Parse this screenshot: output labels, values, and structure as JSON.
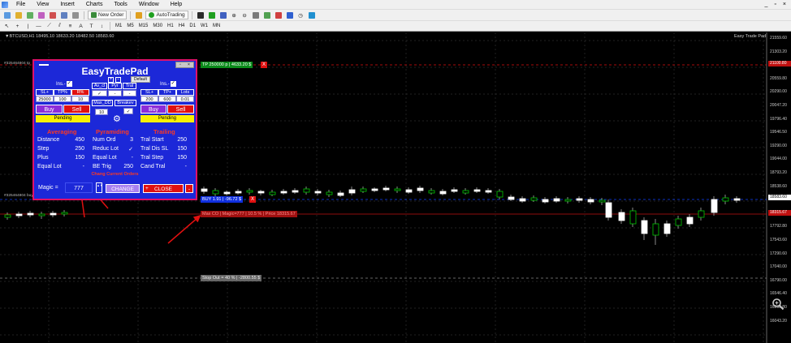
{
  "menu": [
    "File",
    "View",
    "Insert",
    "Charts",
    "Tools",
    "Window",
    "Help"
  ],
  "window_controls": [
    "_",
    "▫",
    "×"
  ],
  "toolbar": {
    "new_order": "New Order",
    "auto_trading": "AutoTrading",
    "timeframes": [
      "M1",
      "M5",
      "M15",
      "M30",
      "H1",
      "H4",
      "D1",
      "W1",
      "MN"
    ]
  },
  "chart": {
    "title": "▼BTCUSD,H1  18495.10 18633.20 18482.50 18583.60",
    "ea_name": "Easy Trade Pad",
    "tp_line": "TP 250000 p | 4633.20 $",
    "buy_line": "BUY 1.91 | -96.72 $",
    "max_line": "Max CO | Magic=777 | 10.5 % | Price 18315.67",
    "stopout_line": "Stop Out = 40 % | -2800.55 $",
    "close_x": "X",
    "ticket_tp": "#325464804 tp",
    "ticket_buy": "#325464804 buy",
    "price_axis": [
      "21559.60",
      "21303.20",
      "21036.80",
      "20559.80",
      "20290.00",
      "20047.20",
      "19796.40",
      "19546.50",
      "19290.00",
      "19044.00",
      "18793.20",
      "18538.60",
      "18290.00",
      "18031.00",
      "17792.80",
      "17543.60",
      "17290.60",
      "17040.00",
      "16790.00",
      "16546.40",
      "16290.80",
      "16043.20"
    ],
    "current_price": "18583.60",
    "red_price": "18315.67",
    "top_price": "21100.80"
  },
  "panel": {
    "title": "EasyTradePad",
    "mini_buttons": [
      "+",
      "-"
    ],
    "default_label": "Default",
    "title_controls": [
      "▫",
      "×"
    ],
    "ins_label": "Ins.-",
    "check": "✓",
    "left": {
      "headers": [
        "SL+",
        "TP%",
        "R%"
      ],
      "values": [
        "25000",
        "100",
        "10"
      ]
    },
    "middle": {
      "headers": [
        "Av_cl",
        "Pyr",
        "Tral"
      ],
      "row2": [
        "✓",
        "-",
        "-"
      ],
      "max_dd_label": "Max_DD",
      "breakeven_label": "Breakev",
      "max_dd_value": "10"
    },
    "right": {
      "headers": [
        "SL+",
        "TP+",
        "Lots"
      ],
      "values": [
        "200",
        "600",
        "0.01"
      ]
    },
    "buy": "Buy",
    "sell": "Sell",
    "pending": "Pending",
    "averaging": {
      "title": "Averaging",
      "rows": [
        {
          "label": "Distance",
          "value": "450"
        },
        {
          "label": "Step",
          "value": "250"
        },
        {
          "label": "Plus",
          "value": "150"
        },
        {
          "label": "Equal Lot",
          "value": "-"
        }
      ]
    },
    "pyramiding": {
      "title": "Pyramiding",
      "rows": [
        {
          "label": "Num Ord",
          "value": "3"
        },
        {
          "label": "Reduc Lot",
          "value": "✓"
        },
        {
          "label": "Equal Lot",
          "value": "-"
        },
        {
          "label": "BE Trig",
          "value": "250"
        }
      ]
    },
    "trailing": {
      "title": "Trailing",
      "rows": [
        {
          "label": "Tral Start",
          "value": "250"
        },
        {
          "label": "Tral Dis SL",
          "value": "150"
        },
        {
          "label": "Tral Step",
          "value": "150"
        },
        {
          "label": "Cand Tral",
          "value": "-"
        }
      ]
    },
    "chang_orders": "Chang Current Orders",
    "magic_label": "Magic =",
    "magic_value": "777",
    "stepper": "▲▼",
    "change": "CHANGE",
    "close_plus": "+",
    "close": "CLOSE",
    "close_minus": "-"
  },
  "colors": {
    "panel_bg": "#1c28d8",
    "panel_border": "#e0106a",
    "buy_button": "#8c2cd8",
    "sell_button": "#e01010",
    "pending_button": "#f8f000",
    "section_heading": "#ff3a20",
    "candle_bull": "#ffffff",
    "candle_bear": "#00c800",
    "grid": "#2e2e2e"
  }
}
